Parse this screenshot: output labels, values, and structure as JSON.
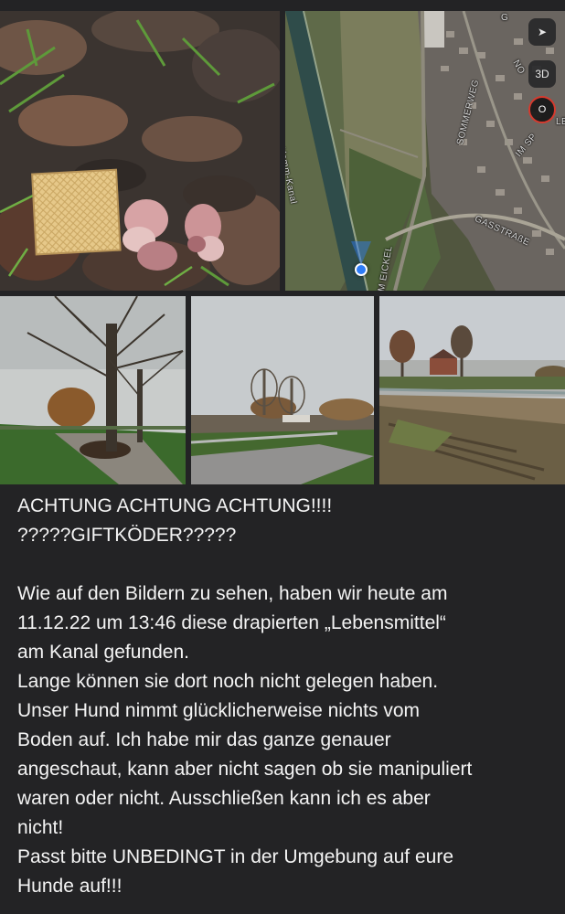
{
  "colors": {
    "background": "#232325",
    "text": "#f4f4f4",
    "location_dot": "#2e7cf6",
    "compass_ring": "#d63a2e"
  },
  "photos": [
    {
      "name": "bait-photo",
      "icon": "photo"
    },
    {
      "name": "map-screenshot",
      "icon": "map"
    },
    {
      "name": "tree-path-photo",
      "icon": "photo"
    },
    {
      "name": "canal-path-photo",
      "icon": "photo"
    },
    {
      "name": "field-track-photo",
      "icon": "photo"
    }
  ],
  "map": {
    "canal_label": "Datteln-Hamm-Kanal",
    "street_sommerweg": "SOMMERWEG",
    "street_gasstrasse": "GASSTRAßE",
    "street_eickel": "M EICKEL",
    "street_imsp": "IM SP",
    "corner_no": "NO",
    "corner_g": "G",
    "corner_le": "LE",
    "btn_3d": "3D",
    "compass_label": "O",
    "location_icon": "location-arrow-icon"
  },
  "message": {
    "line1": "ACHTUNG ACHTUNG ACHTUNG!!!!",
    "line2": "?????GIFTKÖDER?????",
    "line3": "Wie auf den Bildern zu sehen, haben wir heute am",
    "line4": "11.12.22 um 13:46 diese drapierten „Lebensmittel“",
    "line5": "am Kanal gefunden.",
    "line6": "Lange können sie dort noch nicht gelegen haben.",
    "line7": "Unser Hund nimmt glücklicherweise nichts vom",
    "line8": "Boden auf. Ich habe mir das ganze genauer",
    "line9": "angeschaut, kann aber nicht sagen ob sie manipuliert",
    "line10": "waren oder nicht. Ausschließen kann ich es aber",
    "line11": "nicht!",
    "line12": "Passt bitte UNBEDINGT in der Umgebung auf eure",
    "line13": "Hunde auf!!!"
  }
}
